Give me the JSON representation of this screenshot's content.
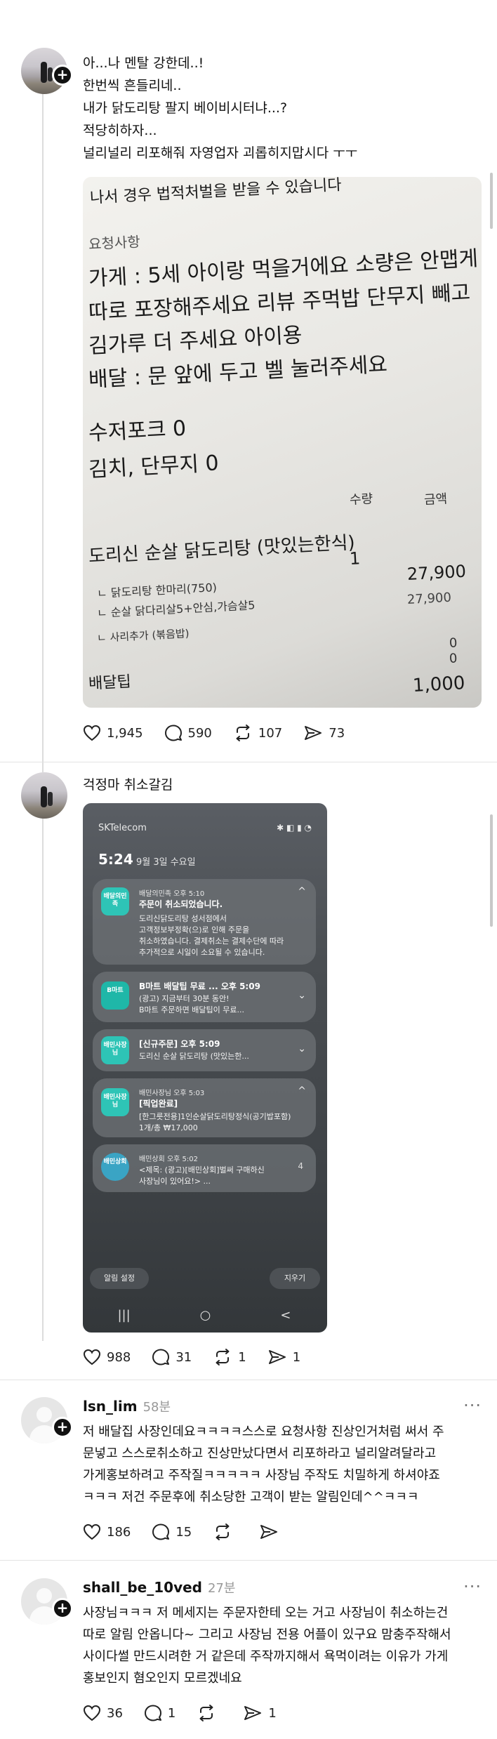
{
  "post1": {
    "lines": [
      "아...나 멘탈 강한데..!",
      "한번씩 흔들리네..",
      "내가 닭도리탕 팔지 베이비시터냐...?",
      "적당히하자...",
      "널리널리 리포해줘 자영업자 괴롭히지맙시다 ㅜㅜ"
    ],
    "receipt_lines": [
      "나서 경우 법적처벌을 받을 수 있습니다",
      "요청사항",
      "가게 : 5세 아이랑 먹을거에요 소량은 안맵게",
      "따로 포장해주세요 리뷰 주먹밥 단무지 빼고",
      "김가루 더 주세요 아이용",
      "배달 : 문 앞에 두고 벨 눌러주세요",
      "수저포크 0",
      "김치, 단무지 0",
      "수량",
      "금액",
      "도리신 순살 닭도리탕 (맛있는한식)",
      "1",
      "27,900",
      "ㄴ 닭도리탕 한마리(750)",
      "27,900",
      "ㄴ 순살 닭다리살5+안심,가슴살5",
      "ㄴ 사리추가 (볶음밥)",
      "0",
      "0",
      "배달팁",
      "1,000"
    ],
    "likes": "1,945",
    "comments": "590",
    "reposts": "107",
    "shares": "73"
  },
  "post2": {
    "text": "걱정마 취소갈김",
    "phone": {
      "carrier": "SKTelecom",
      "time": "5:24",
      "date": "9월 3일 수요일",
      "notifications": [
        {
          "icon": "배달의민족",
          "app": "배달의민족  오후 5:10",
          "title": "주문이 취소되었습니다.",
          "body": [
            "도리신닭도리탕 성서점에서",
            "고객정보부정확(으)로 인해 주문을",
            "취소하였습니다. 결제취소는 결제수단에 따라",
            "추가적으로 시일이 소요될 수 있습니다."
          ]
        },
        {
          "icon": "B마트",
          "app": "B마트 배달팁 무료 ...  오후 5:09",
          "title": "",
          "body": [
            "(광고) 지금부터 30분 동안!",
            "B마트 주문하면 배달팁이 무료..."
          ]
        },
        {
          "icon": "배민사장님",
          "app": "[신규주문]  오후 5:09",
          "title": "",
          "body": [
            "도리신 순살 닭도리탕 (맛있는한..."
          ]
        },
        {
          "icon": "배민사장님",
          "app": "배민사장님  오후 5:03",
          "title": "[픽업완료]",
          "body": [
            "[한그릇전용]1인순살닭도리탕정식(공기밥포함)",
            "1개/총 ₩17,000"
          ]
        },
        {
          "icon": "배민상회",
          "app": "배민상회  오후 5:02",
          "title": "",
          "body": [
            "<제목: (광고)[배민상회]벌써 구매하신",
            "사장님이 있어요!> ..."
          ],
          "count": "4"
        }
      ],
      "settings_button": "알림 설정",
      "clear_button": "지우기",
      "nav": [
        "|||",
        "○",
        "<"
      ]
    },
    "likes": "988",
    "comments": "31",
    "reposts": "1",
    "shares": "1"
  },
  "reply1": {
    "username": "lsn_lim",
    "time": "58분",
    "lines": [
      "저 배달집 사장인데요ㅋㅋㅋㅋ스스로 요청사항 진상인거처럼  써서 주",
      "문넣고 스스로취소하고 진상만났다면서 리포하라고 널리알려달라고",
      "가게홍보하려고 주작질ㅋㅋㅋㅋㅋ 사장님  주작도 치밀하게 하셔야죠",
      "ㅋㅋㅋ 저건 주문후에 취소당한 고객이 받는 알림인데^^ㅋㅋㅋ"
    ],
    "likes": "186",
    "comments": "15"
  },
  "reply2": {
    "username": "shall_be_10ved",
    "time": "27분",
    "lines": [
      "사장님ㅋㅋㅋ 저 메세지는 주문자한테 오는 거고 사장님이 취소하는건",
      "따로 알림 안옵니다~ 그리고 사장님 전용 어플이 있구요 맘충주작해서",
      "사이다썰 만드시려한 거 같은데 주작까지해서 욕먹이려는 이유가 가게",
      "홍보인지 혐오인지 모르겠네요"
    ],
    "likes": "36",
    "comments": "1",
    "shares": "1"
  },
  "ui": {
    "more": "···",
    "plus": "+"
  }
}
